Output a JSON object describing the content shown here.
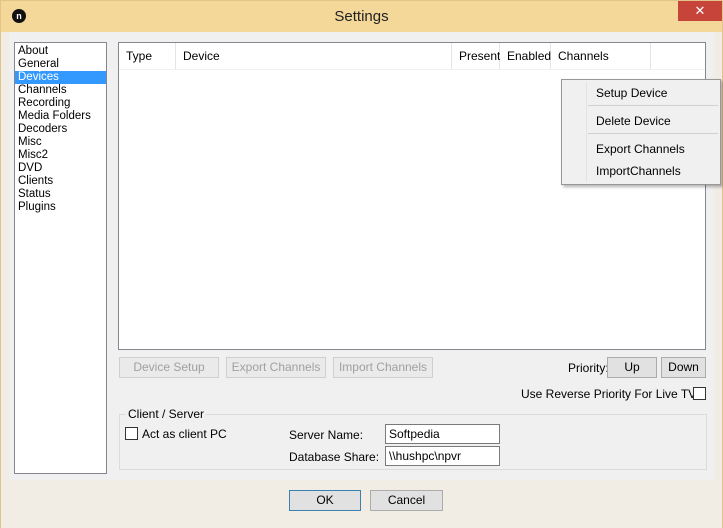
{
  "window": {
    "title": "Settings",
    "icon_letter": "n",
    "close_glyph": "✕"
  },
  "nav": {
    "items": [
      {
        "label": "About",
        "selected": false
      },
      {
        "label": "General",
        "selected": false
      },
      {
        "label": "Devices",
        "selected": true
      },
      {
        "label": "Channels",
        "selected": false
      },
      {
        "label": "Recording",
        "selected": false
      },
      {
        "label": "Media Folders",
        "selected": false
      },
      {
        "label": "Decoders",
        "selected": false
      },
      {
        "label": "Misc",
        "selected": false
      },
      {
        "label": "Misc2",
        "selected": false
      },
      {
        "label": "DVD",
        "selected": false
      },
      {
        "label": "Clients",
        "selected": false
      },
      {
        "label": "Status",
        "selected": false
      },
      {
        "label": "Plugins",
        "selected": false
      }
    ]
  },
  "devices": {
    "columns": [
      "Type",
      "Device",
      "Present",
      "Enabled",
      "Channels"
    ],
    "rows": []
  },
  "context_menu": {
    "setup": "Setup Device",
    "delete": "Delete Device",
    "export": "Export Channels",
    "import": "ImportChannels"
  },
  "actions": {
    "device_setup": "Device Setup",
    "export_channels": "Export Channels",
    "import_channels": "Import Channels",
    "priority_label": "Priority:",
    "up": "Up",
    "down": "Down",
    "reverse_priority": "Use Reverse Priority For Live TV"
  },
  "client_server": {
    "legend": "Client / Server",
    "act_as_client": "Act as client PC",
    "server_name_label": "Server Name:",
    "server_name_value": "Softpedia",
    "db_share_label": "Database Share:",
    "db_share_value": "\\\\hushpc\\npvr"
  },
  "footer": {
    "ok": "OK",
    "cancel": "Cancel"
  },
  "colors": {
    "titlebar": "#f3d89a",
    "selection": "#3399ff",
    "close": "#c7443b"
  }
}
